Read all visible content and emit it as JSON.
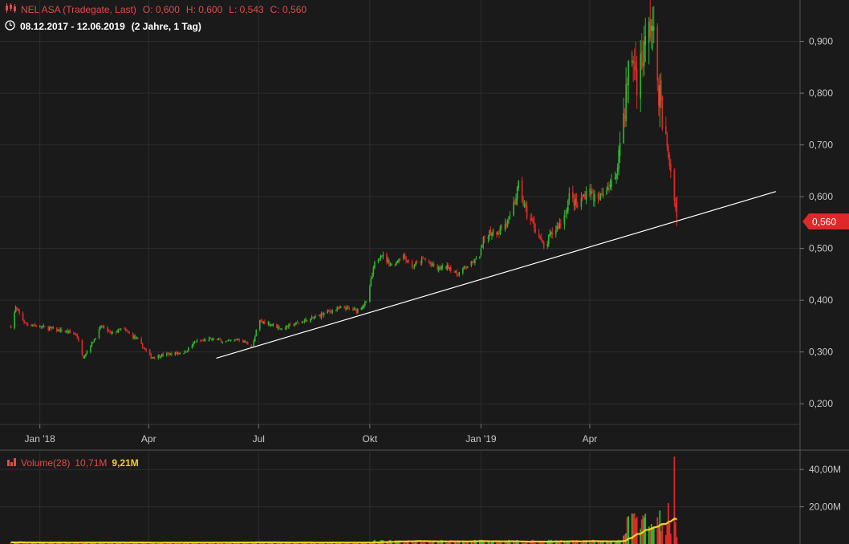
{
  "header": {
    "instrument": "NEL ASA (Tradegate, Last)",
    "ohlc": [
      {
        "label": "O:",
        "value": "0,600"
      },
      {
        "label": "H:",
        "value": "0,600"
      },
      {
        "label": "L:",
        "value": "0,543"
      },
      {
        "label": "C:",
        "value": "0,560"
      }
    ],
    "date_range": "08.12.2017 - 12.06.2019",
    "duration": "(2 Jahre, 1 Tag)"
  },
  "volume_header": {
    "label": "Volume(28)",
    "value1": "10,71M",
    "value2": "9,21M"
  },
  "colors": {
    "background": "#1a1a1a",
    "grid": "#2c2c2c",
    "up": "#2db82d",
    "down": "#e02828",
    "price_tag": "#e02828",
    "trendline": "#ffffff",
    "volume_ma": "#f5d020"
  },
  "chart_data": {
    "type": "candlestick",
    "price_axis": {
      "ylim": [
        0.16,
        0.98
      ],
      "ticks": [
        0.2,
        0.3,
        0.4,
        0.5,
        0.6,
        0.7,
        0.8,
        0.9
      ],
      "tick_labels": [
        "0,200",
        "0,300",
        "0,400",
        "0,500",
        "0,600",
        "0,700",
        "0,800",
        "0,900"
      ]
    },
    "time_axis": {
      "range": [
        "2017-12-08",
        "2019-06-12"
      ],
      "ticks": [
        {
          "date": "2018-01-01",
          "label": "Jan '18"
        },
        {
          "date": "2018-04-01",
          "label": "Apr"
        },
        {
          "date": "2018-07-01",
          "label": "Jul"
        },
        {
          "date": "2018-10-01",
          "label": "Okt"
        },
        {
          "date": "2019-01-01",
          "label": "Jan '19"
        },
        {
          "date": "2019-04-01",
          "label": "Apr"
        }
      ]
    },
    "last_price": {
      "value": 0.56,
      "label": "0,560"
    },
    "price_path": [
      [
        "2017-12-08",
        0.35
      ],
      [
        "2017-12-12",
        0.385
      ],
      [
        "2017-12-20",
        0.355
      ],
      [
        "2018-01-10",
        0.345
      ],
      [
        "2018-01-20",
        0.34
      ],
      [
        "2018-01-31",
        0.335
      ],
      [
        "2018-02-06",
        0.29
      ],
      [
        "2018-02-15",
        0.325
      ],
      [
        "2018-02-21",
        0.35
      ],
      [
        "2018-03-01",
        0.335
      ],
      [
        "2018-03-10",
        0.345
      ],
      [
        "2018-03-22",
        0.325
      ],
      [
        "2018-04-03",
        0.29
      ],
      [
        "2018-04-15",
        0.295
      ],
      [
        "2018-05-01",
        0.3
      ],
      [
        "2018-05-10",
        0.32
      ],
      [
        "2018-05-25",
        0.325
      ],
      [
        "2018-06-05",
        0.32
      ],
      [
        "2018-06-15",
        0.325
      ],
      [
        "2018-06-26",
        0.31
      ],
      [
        "2018-07-01",
        0.36
      ],
      [
        "2018-07-10",
        0.355
      ],
      [
        "2018-07-20",
        0.345
      ],
      [
        "2018-08-01",
        0.355
      ],
      [
        "2018-08-15",
        0.365
      ],
      [
        "2018-08-30",
        0.38
      ],
      [
        "2018-09-10",
        0.385
      ],
      [
        "2018-09-20",
        0.38
      ],
      [
        "2018-09-28",
        0.395
      ],
      [
        "2018-10-05",
        0.47
      ],
      [
        "2018-10-10",
        0.49
      ],
      [
        "2018-10-20",
        0.465
      ],
      [
        "2018-10-28",
        0.49
      ],
      [
        "2018-11-05",
        0.465
      ],
      [
        "2018-11-15",
        0.48
      ],
      [
        "2018-11-25",
        0.46
      ],
      [
        "2018-12-05",
        0.465
      ],
      [
        "2018-12-12",
        0.45
      ],
      [
        "2018-12-20",
        0.465
      ],
      [
        "2018-12-30",
        0.48
      ],
      [
        "2019-01-05",
        0.53
      ],
      [
        "2019-01-15",
        0.535
      ],
      [
        "2019-01-25",
        0.555
      ],
      [
        "2019-02-01",
        0.62
      ],
      [
        "2019-02-08",
        0.565
      ],
      [
        "2019-02-15",
        0.54
      ],
      [
        "2019-02-22",
        0.5
      ],
      [
        "2019-03-01",
        0.53
      ],
      [
        "2019-03-10",
        0.555
      ],
      [
        "2019-03-15",
        0.6
      ],
      [
        "2019-03-22",
        0.58
      ],
      [
        "2019-03-30",
        0.615
      ],
      [
        "2019-04-08",
        0.59
      ],
      [
        "2019-04-15",
        0.62
      ],
      [
        "2019-04-22",
        0.63
      ],
      [
        "2019-04-30",
        0.78
      ],
      [
        "2019-05-05",
        0.88
      ],
      [
        "2019-05-10",
        0.83
      ],
      [
        "2019-05-15",
        0.87
      ],
      [
        "2019-05-18",
        0.9
      ],
      [
        "2019-05-22",
        0.94
      ],
      [
        "2019-05-27",
        0.83
      ],
      [
        "2019-06-01",
        0.73
      ],
      [
        "2019-06-05",
        0.68
      ],
      [
        "2019-06-10",
        0.6
      ],
      [
        "2019-06-12",
        0.56
      ]
    ],
    "trendline": {
      "start": {
        "date": "2018-05-27",
        "value": 0.288
      },
      "end": {
        "date": "2019-09-02",
        "value": 0.61
      }
    },
    "volume": {
      "ylim": [
        0,
        50000000
      ],
      "ticks": [
        20000000,
        40000000
      ],
      "tick_labels": [
        "20,00M",
        "40,00M"
      ],
      "ma_period": 28,
      "notable_bars": [
        {
          "date": "2019-06-10",
          "value": 47000000
        },
        {
          "date": "2019-06-05",
          "value": 22000000
        },
        {
          "date": "2019-05-29",
          "value": 18000000
        }
      ]
    }
  }
}
